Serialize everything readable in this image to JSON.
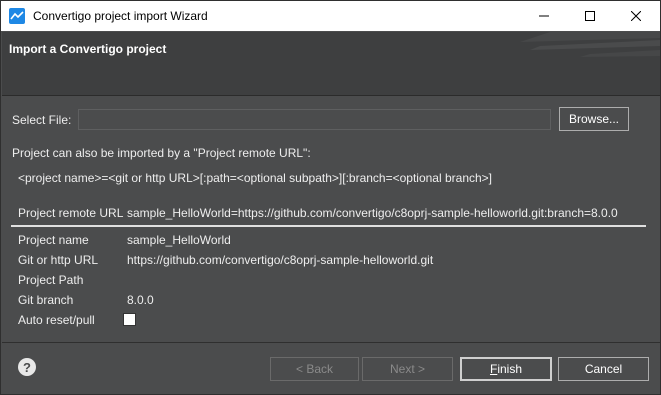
{
  "window": {
    "title": "Convertigo project import Wizard",
    "controls": {
      "minimize": "minimize-icon",
      "maximize": "maximize-icon",
      "close": "close-icon"
    }
  },
  "banner": {
    "title": "Import a Convertigo project"
  },
  "file": {
    "label": "Select File:",
    "value": "",
    "browse_label": "Browse..."
  },
  "info": {
    "intro": "Project can also be imported by a \"Project remote URL\":",
    "format": "<project name>=<git or http URL>[:path=<optional subpath>][:branch=<optional branch>]"
  },
  "remote": {
    "label": "Project remote URL",
    "value": "sample_HelloWorld=https://github.com/convertigo/c8oprj-sample-helloworld.git:branch=8.0.0"
  },
  "fields": [
    {
      "label": "Project name",
      "value": "sample_HelloWorld"
    },
    {
      "label": "Git or http URL",
      "value": "https://github.com/convertigo/c8oprj-sample-helloworld.git"
    },
    {
      "label": "Project Path",
      "value": ""
    },
    {
      "label": "Git branch",
      "value": "8.0.0"
    },
    {
      "label": "Auto reset/pull",
      "checked": false
    }
  ],
  "footer": {
    "help_icon": "help-icon",
    "back_label": "< Back",
    "next_label": "Next >",
    "finish_first": "F",
    "finish_rest": "inish",
    "cancel_label": "Cancel"
  },
  "colors": {
    "background": "#4b4c4d",
    "banner": "#3e3f40",
    "accent": "#1e88e5",
    "text": "#eeeeee"
  }
}
